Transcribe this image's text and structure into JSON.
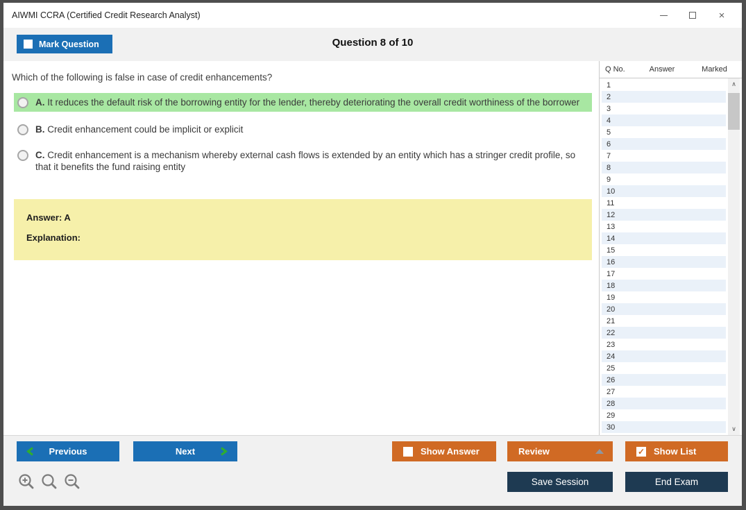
{
  "window": {
    "title": "AIWMI CCRA (Certified Credit Research Analyst)"
  },
  "icons": {
    "close": "×",
    "scroll_up": "∧",
    "scroll_down": "∨",
    "check": "✓"
  },
  "header": {
    "mark_question": "Mark Question",
    "counter": "Question 8 of 10"
  },
  "question": {
    "text": "Which of the following is false in case of credit enhancements?",
    "options": [
      {
        "letter": "A.",
        "text": "It reduces the default risk of the borrowing entity for the lender, thereby deteriorating the overall credit worthiness of the borrower",
        "highlighted": true
      },
      {
        "letter": "B.",
        "text": "Credit enhancement could be implicit or explicit",
        "highlighted": false
      },
      {
        "letter": "C.",
        "text": "Credit enhancement is a mechanism whereby external cash flows is extended by an entity which has a stringer credit profile, so that it benefits the fund raising entity",
        "highlighted": false
      }
    ],
    "answer": "Answer: A",
    "explanation": "Explanation:"
  },
  "question_list": {
    "columns": [
      "Q No.",
      "Answer",
      "Marked"
    ],
    "q_numbers": [
      "1",
      "2",
      "3",
      "4",
      "5",
      "6",
      "7",
      "8",
      "9",
      "10",
      "11",
      "12",
      "13",
      "14",
      "15",
      "16",
      "17",
      "18",
      "19",
      "20",
      "21",
      "22",
      "23",
      "24",
      "25",
      "26",
      "27",
      "28",
      "29",
      "30"
    ]
  },
  "footer": {
    "previous": "Previous",
    "next": "Next",
    "show_answer": "Show Answer",
    "review": "Review",
    "show_list": "Show List",
    "save_session": "Save Session",
    "end_exam": "End Exam"
  },
  "colors": {
    "accent_blue": "#1b6fb5",
    "accent_orange": "#d06a24",
    "navy": "#1e3a52",
    "option_highlight": "#a8e7a2",
    "answer_bg": "#f6f0aa",
    "row_stripe": "#eaf1f9",
    "chevron_green": "#2fae2f"
  }
}
